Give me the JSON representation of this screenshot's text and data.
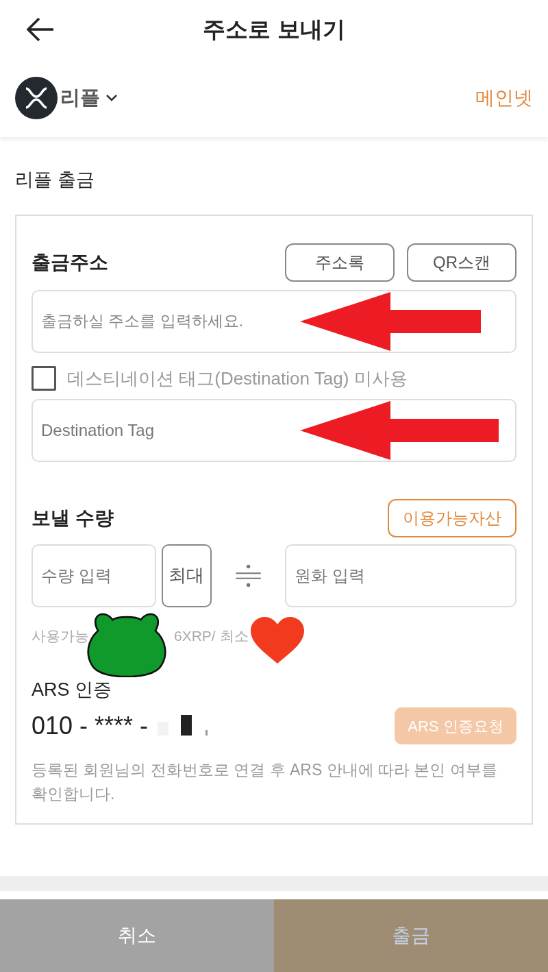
{
  "header": {
    "title": "주소로 보내기"
  },
  "coin": {
    "name": "리플",
    "network": "메인넷"
  },
  "section_title": "리플 출금",
  "address": {
    "label": "출금주소",
    "buttons": [
      "주소록",
      "QR스캔"
    ],
    "placeholder": "출금하실 주소를 입력하세요."
  },
  "destination_tag": {
    "checkbox_label": "데스티네이션 태그(Destination Tag) 미사용",
    "checked": false,
    "placeholder": "Destination Tag"
  },
  "amount": {
    "label": "보낼 수량",
    "available_button": "이용가능자산",
    "quantity_placeholder": "수량 입력",
    "max_button": "최대",
    "fiat_placeholder": "원화 입력",
    "hint_parts": [
      "사용가능",
      "6XRP/ 최소"
    ]
  },
  "ars": {
    "label": "ARS 인증",
    "phone": "010 - **** -",
    "request_button": "ARS 인증요청",
    "disabled": true,
    "notice": "등록된 회원님의 전화번호로 연결 후 ARS 안내에 따라 본인 여부를 확인합니다."
  },
  "footer": {
    "cancel": "취소",
    "submit": "출금"
  }
}
